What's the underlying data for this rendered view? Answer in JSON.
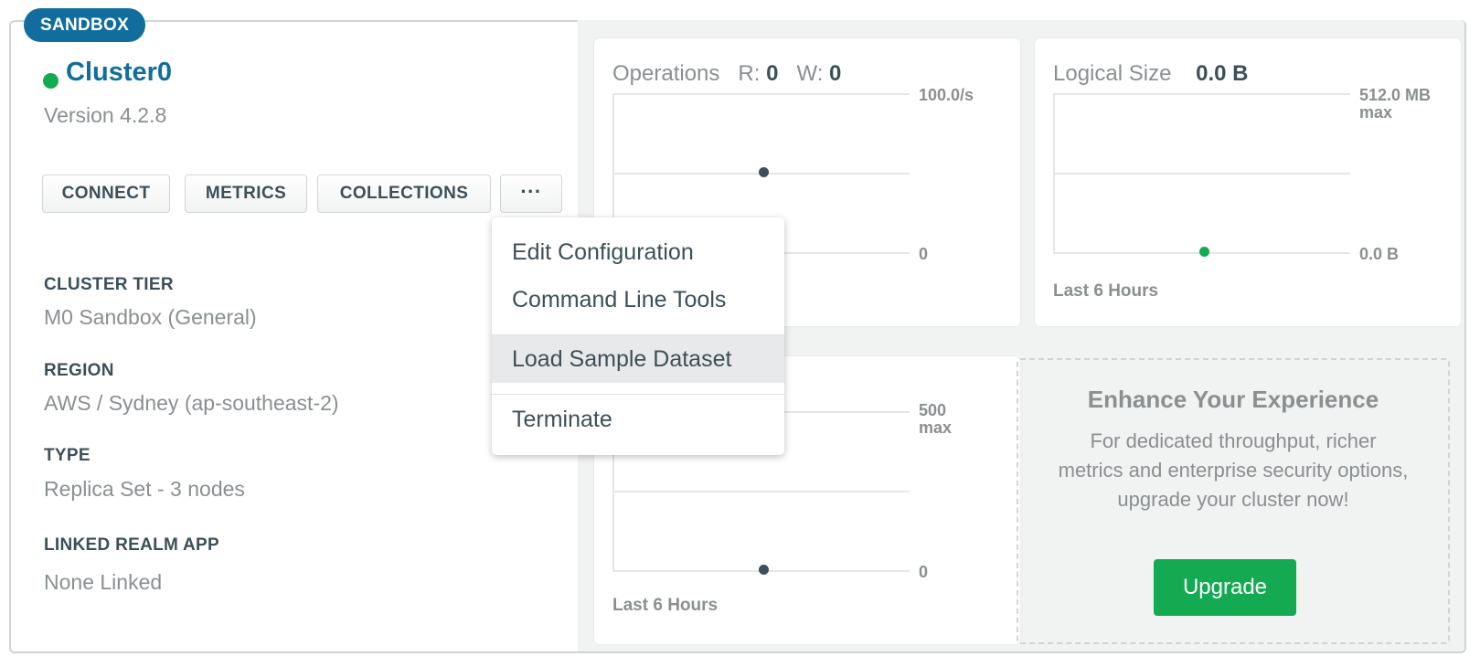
{
  "badge": "SANDBOX",
  "cluster": {
    "name": "Cluster0",
    "version": "Version 4.2.8",
    "status_color": "#13aa52"
  },
  "buttons": {
    "connect": "CONNECT",
    "metrics": "METRICS",
    "collections": "COLLECTIONS",
    "more": "···"
  },
  "details": [
    {
      "label": "CLUSTER TIER",
      "value": "M0 Sandbox (General)"
    },
    {
      "label": "REGION",
      "value": "AWS / Sydney (ap-southeast-2)"
    },
    {
      "label": "TYPE",
      "value": "Replica Set - 3 nodes"
    },
    {
      "label": "LINKED REALM APP",
      "value": "None Linked"
    }
  ],
  "operations": {
    "title": "Operations",
    "r_label": "R:",
    "r_value": "0",
    "w_label": "W:",
    "w_value": "0",
    "max_label": "100.0/s",
    "min_label": "0"
  },
  "logical_size": {
    "title": "Logical Size",
    "value": "0.0 B",
    "max_label": "512.0 MB",
    "max_sub": "max",
    "min_label": "0.0 B",
    "footer": "Last 6 Hours",
    "dot_color": "#13aa52"
  },
  "connections": {
    "max_label": "500",
    "max_sub": "max",
    "min_label": "0",
    "footer": "Last 6 Hours"
  },
  "promo": {
    "title": "Enhance Your Experience",
    "text": "For dedicated throughput, richer metrics and enterprise security options, upgrade your cluster now!",
    "button": "Upgrade"
  },
  "menu": {
    "items": [
      "Edit Configuration",
      "Command Line Tools",
      "Load Sample Dataset",
      "Terminate"
    ],
    "highlighted": "Load Sample Dataset"
  },
  "colors": {
    "brand_blue": "#116d9b",
    "green": "#13aa52"
  }
}
